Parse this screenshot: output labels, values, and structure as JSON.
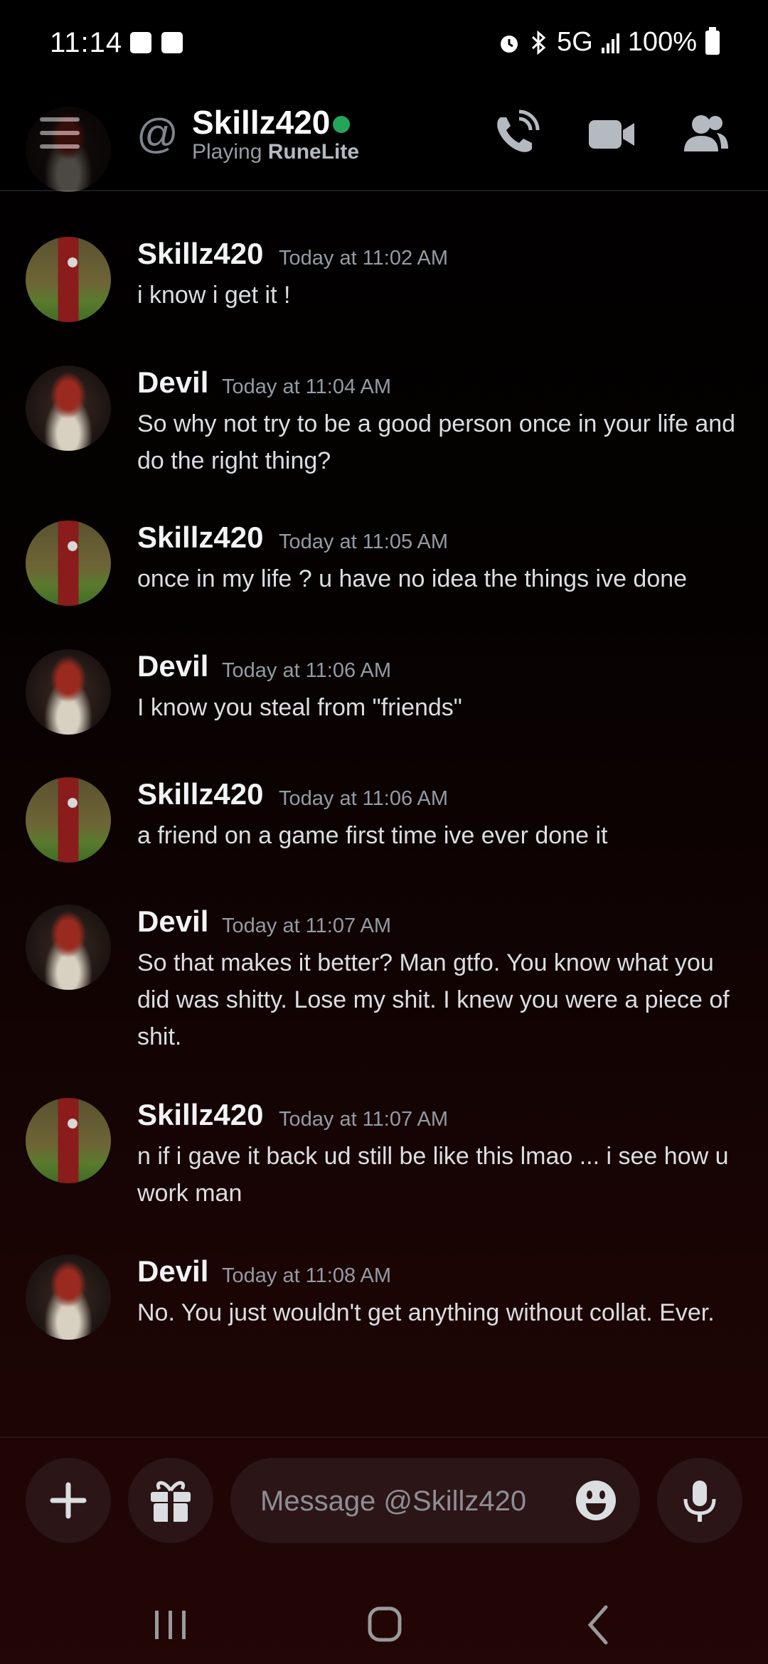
{
  "status_bar": {
    "time": "11:14",
    "network": "5G",
    "battery": "100%"
  },
  "header": {
    "at_symbol": "@",
    "username": "Skillz420",
    "activity_prefix": "Playing ",
    "activity_game": "RuneLite",
    "online_color": "#23a55a"
  },
  "messages": [
    {
      "author": "Skillz420",
      "timestamp": "Today at 11:02 AM",
      "text": "i know i get it !"
    },
    {
      "author": "Devil",
      "timestamp": "Today at 11:04 AM",
      "text": "So why not try to be a good person once in your life and do the right thing?"
    },
    {
      "author": "Skillz420",
      "timestamp": "Today at 11:05 AM",
      "text": "once in my life ? u have no idea the things ive done"
    },
    {
      "author": "Devil",
      "timestamp": "Today at 11:06 AM",
      "text": "I know you steal from \"friends\""
    },
    {
      "author": "Skillz420",
      "timestamp": "Today at 11:06 AM",
      "text": "a friend on a game first time ive ever done it"
    },
    {
      "author": "Devil",
      "timestamp": "Today at 11:07 AM",
      "text": "So that makes it better? Man gtfo. You know what you did was shitty. Lose my shit. I knew you were a piece of shit."
    },
    {
      "author": "Skillz420",
      "timestamp": "Today at 11:07 AM",
      "text": "n if i gave it back ud still be like this lmao ... i see how u work man"
    },
    {
      "author": "Devil",
      "timestamp": "Today at 11:08 AM",
      "text": "No. You just wouldn't get anything without collat. Ever."
    }
  ],
  "composer": {
    "placeholder": "Message @Skillz420",
    "value": ""
  },
  "icons": {
    "menu": "hamburger-menu-icon",
    "call": "phone-call-icon",
    "video": "video-camera-icon",
    "members": "members-icon",
    "add": "plus-icon",
    "gift": "gift-icon",
    "emoji": "emoji-icon",
    "mic": "microphone-icon"
  }
}
